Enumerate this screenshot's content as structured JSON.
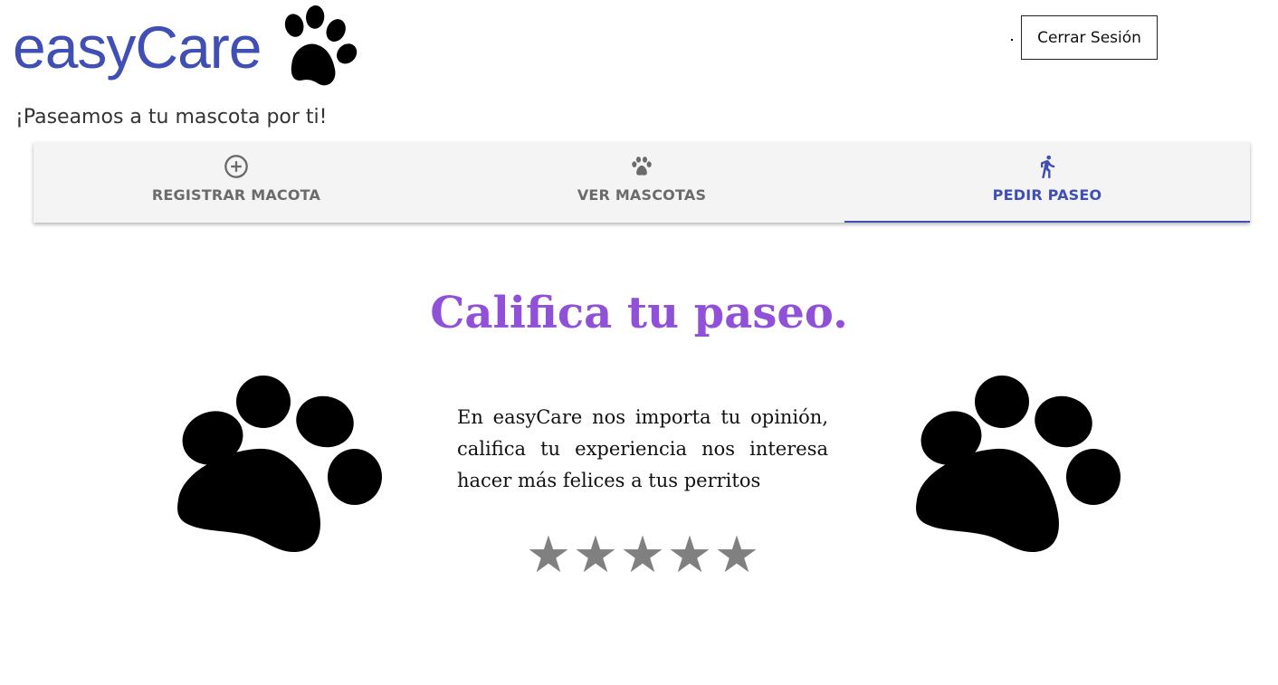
{
  "header": {
    "logo_text": "easyCare",
    "tagline": "¡Paseamos a tu mascota por ti!",
    "logout_label": "Cerrar Sesión"
  },
  "tabs": [
    {
      "label": "REGISTRAR MACOTA",
      "icon": "add-circle-icon",
      "active": false
    },
    {
      "label": "VER MASCOTAS",
      "icon": "paw-icon",
      "active": false
    },
    {
      "label": "PEDIR PASEO",
      "icon": "walk-icon",
      "active": true
    }
  ],
  "main": {
    "heading": "Califica tu paseo.",
    "message": "En easyCare nos importa tu opinión, califica tu experiencia nos interesa hacer más felices a tus perritos",
    "rating": {
      "max": 5,
      "value": 0,
      "star_glyph": "★"
    }
  },
  "colors": {
    "brand": "#3f4fb4",
    "heading": "#9150d8",
    "star": "#808080",
    "tab_bg": "#f4f4f4"
  }
}
